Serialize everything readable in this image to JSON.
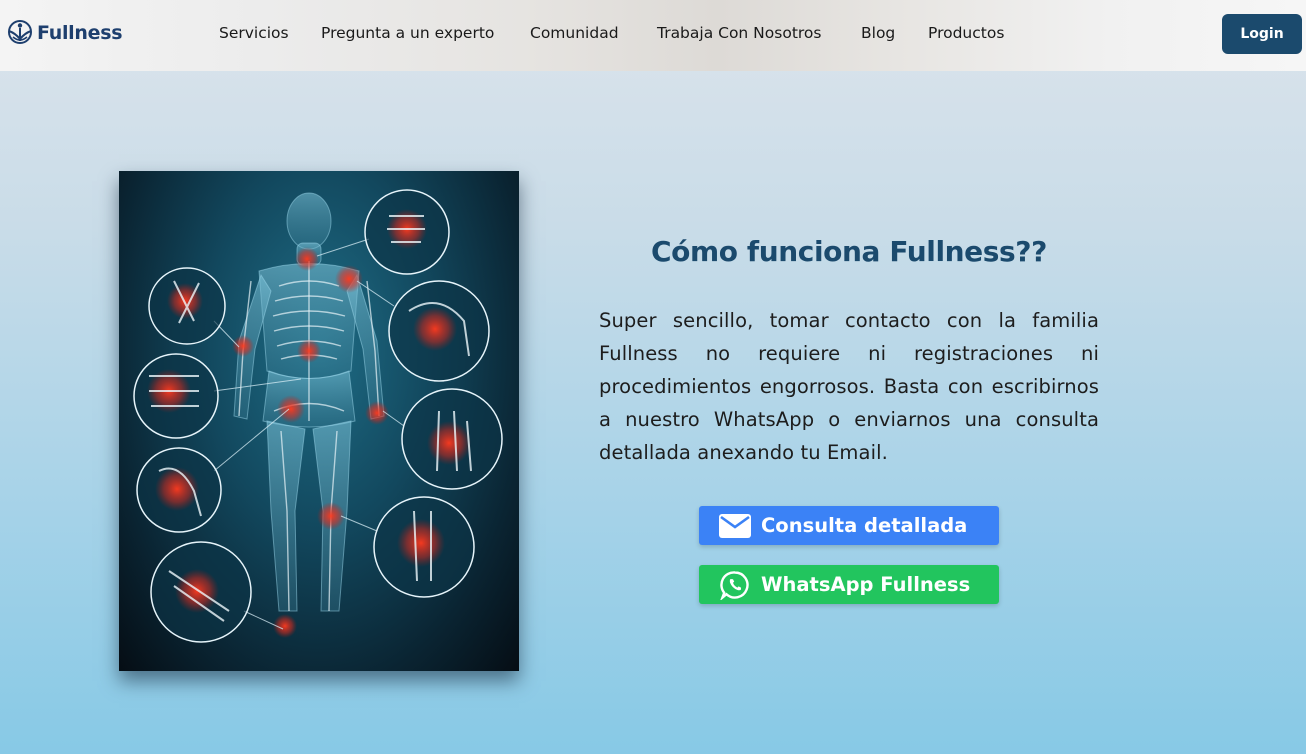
{
  "brand": {
    "name": "Fullness",
    "color": "#1e3f6e"
  },
  "nav": {
    "items": [
      {
        "label": "Servicios"
      },
      {
        "label": "Pregunta a un experto"
      },
      {
        "label": "Comunidad"
      },
      {
        "label": "Trabaja Con Nosotros"
      },
      {
        "label": "Blog"
      },
      {
        "label": "Productos"
      }
    ],
    "login_label": "Login"
  },
  "hero": {
    "heading": "Cómo funciona Fullness??",
    "body": "Super sencillo, tomar contacto con la familia Fullness no requiere ni registraciones ni procedimientos engorrosos. Basta con escribirnos a nuestro WhatsApp o enviarnos una consulta detallada anexando tu Email."
  },
  "buttons": {
    "email": {
      "label": "Consulta detallada",
      "icon": "envelope-icon",
      "color": "#3b82f6"
    },
    "whatsapp": {
      "label": "WhatsApp Fullness",
      "icon": "whatsapp-icon",
      "color": "#22c55e"
    }
  },
  "colors": {
    "primary": "#1b4a6d",
    "text": "#1d1d1d"
  }
}
